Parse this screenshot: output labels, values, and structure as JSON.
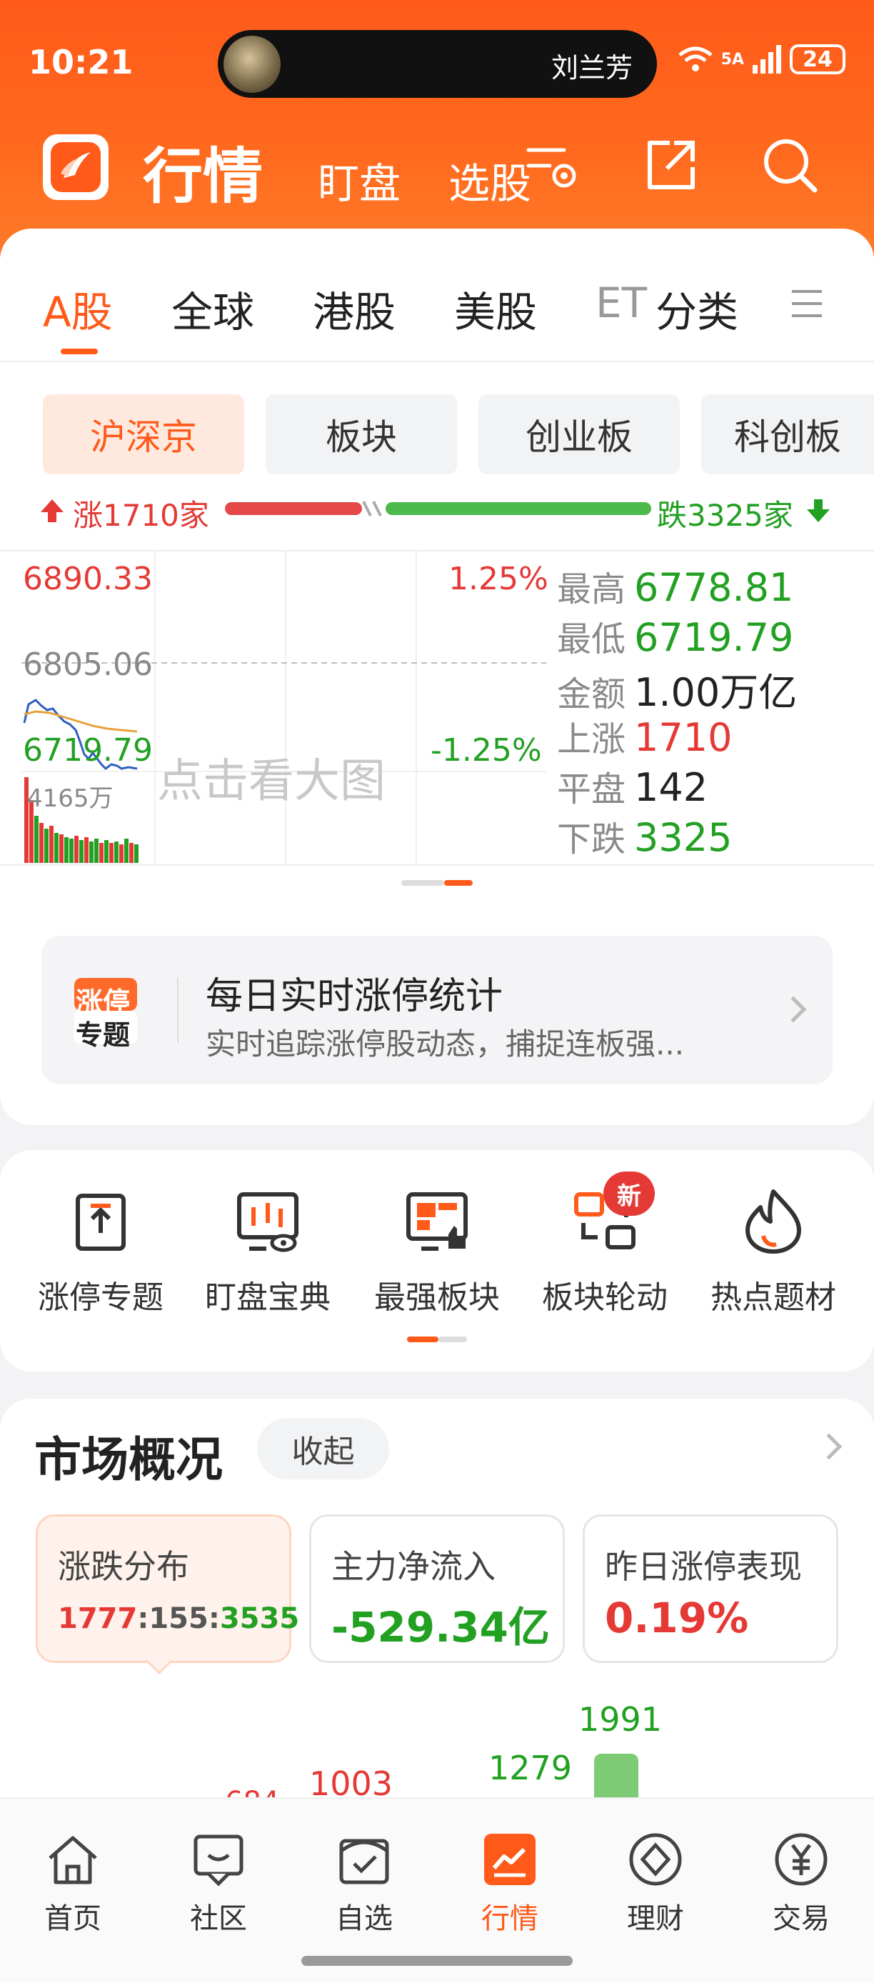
{
  "status_bar": {
    "time": "10:21",
    "live_name": "刘兰芳",
    "battery": "24",
    "network": "5A"
  },
  "header": {
    "title": "行情",
    "tabs": [
      "盯盘",
      "选股"
    ]
  },
  "market_tabs": [
    {
      "label": "A股",
      "active": true
    },
    {
      "label": "全球",
      "active": false
    },
    {
      "label": "港股",
      "active": false
    },
    {
      "label": "美股",
      "active": false
    },
    {
      "label": "ET",
      "active": false
    },
    {
      "label": "分类",
      "active": false
    }
  ],
  "sub_tabs": [
    {
      "label": "沪深京",
      "active": true
    },
    {
      "label": "板块",
      "active": false
    },
    {
      "label": "创业板",
      "active": false
    },
    {
      "label": "科创板",
      "active": false
    }
  ],
  "breadth": {
    "up_label": "涨1710家",
    "down_label": "跌3325家",
    "up": 1710,
    "down": 3325
  },
  "intraday_chart": {
    "high_price": "6890.33",
    "prev_close": "6805.06",
    "low_price": "6719.79",
    "high_pct": "1.25%",
    "low_pct": "-1.25%",
    "volume": "4165万",
    "overlay_hint": "点击看大图"
  },
  "stats": [
    {
      "key": "最高",
      "value": "6778.81",
      "color": "green"
    },
    {
      "key": "最低",
      "value": "6719.79",
      "color": "green"
    },
    {
      "key": "金额",
      "value": "1.00万亿",
      "color": "black"
    },
    {
      "key": "上涨",
      "value": "1710",
      "color": "red"
    },
    {
      "key": "平盘",
      "value": "142",
      "color": "black"
    },
    {
      "key": "下跌",
      "value": "3325",
      "color": "green"
    }
  ],
  "banner": {
    "badge_line1": "涨停",
    "badge_line2": "专题",
    "title": "每日实时涨停统计",
    "subtitle": "实时追踪涨停股动态，捕捉连板强..."
  },
  "quick_entries": [
    {
      "label": "涨停专题",
      "icon": "limit-up-topic-icon"
    },
    {
      "label": "盯盘宝典",
      "icon": "watch-guide-icon"
    },
    {
      "label": "最强板块",
      "icon": "strongest-sector-icon"
    },
    {
      "label": "板块轮动",
      "icon": "sector-rotation-icon",
      "badge": "新"
    },
    {
      "label": "热点题材",
      "icon": "hot-topic-icon"
    }
  ],
  "market_overview": {
    "title": "市场概况",
    "collapse": "收起",
    "cards": [
      {
        "title": "涨跌分布",
        "up": "1777",
        "flat": "155",
        "down": "3535",
        "active": true
      },
      {
        "title": "主力净流入",
        "value": "-529.34亿",
        "color": "green"
      },
      {
        "title": "昨日涨停表现",
        "value": "0.19%",
        "color": "red"
      }
    ],
    "bar_labels": [
      "1003",
      "1279",
      "1991"
    ]
  },
  "bottom_nav": [
    {
      "label": "首页",
      "icon": "home-icon"
    },
    {
      "label": "社区",
      "icon": "community-icon"
    },
    {
      "label": "自选",
      "icon": "watchlist-icon"
    },
    {
      "label": "行情",
      "icon": "market-icon",
      "active": true
    },
    {
      "label": "理财",
      "icon": "wealth-icon"
    },
    {
      "label": "交易",
      "icon": "trade-icon"
    }
  ]
}
